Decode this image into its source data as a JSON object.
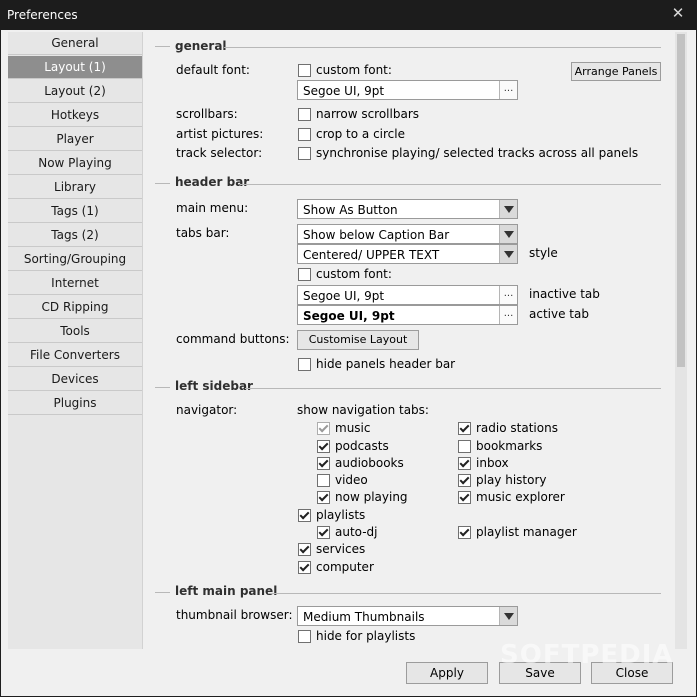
{
  "window": {
    "title": "Preferences",
    "close_glyph": "✕"
  },
  "sidebar": {
    "items": [
      {
        "label": "General"
      },
      {
        "label": "Layout (1)"
      },
      {
        "label": "Layout (2)"
      },
      {
        "label": "Hotkeys"
      },
      {
        "label": "Player"
      },
      {
        "label": "Now Playing"
      },
      {
        "label": "Library"
      },
      {
        "label": "Tags (1)"
      },
      {
        "label": "Tags (2)"
      },
      {
        "label": "Sorting/Grouping"
      },
      {
        "label": "Internet"
      },
      {
        "label": "CD Ripping"
      },
      {
        "label": "Tools"
      },
      {
        "label": "File Converters"
      },
      {
        "label": "Devices"
      },
      {
        "label": "Plugins"
      }
    ],
    "selected": "Layout (1)"
  },
  "general": {
    "heading": "general",
    "default_font_label": "default font:",
    "custom_font_label": "custom font:",
    "custom_font_checked": false,
    "font_value": "Segoe UI, 9pt",
    "arrange_panels": "Arrange Panels",
    "scrollbars_label": "scrollbars:",
    "narrow_scrollbars": "narrow scrollbars",
    "narrow_scrollbars_checked": false,
    "artist_pictures_label": "artist pictures:",
    "crop_circle": "crop to a circle",
    "crop_circle_checked": false,
    "track_selector_label": "track selector:",
    "synchronise": "synchronise playing/ selected tracks across all panels",
    "synchronise_checked": false
  },
  "header_bar": {
    "heading": "header bar",
    "main_menu_label": "main menu:",
    "main_menu_value": "Show As Button",
    "tabs_bar_label": "tabs bar:",
    "tabs_bar_value": "Show below Caption Bar",
    "style_value": "Centered/ UPPER TEXT",
    "style_label": "style",
    "custom_font_label": "custom font:",
    "custom_font_checked": false,
    "inactive_font": "Segoe UI, 9pt",
    "inactive_label": "inactive tab",
    "active_font": "Segoe UI, 9pt",
    "active_label": "active tab",
    "command_buttons_label": "command buttons:",
    "customise_layout": "Customise Layout",
    "hide_panels_header": "hide panels header bar",
    "hide_panels_header_checked": false
  },
  "left_sidebar": {
    "heading": "left sidebar",
    "navigator_label": "navigator:",
    "show_tabs_label": "show navigation tabs:",
    "music": "music",
    "music_checked": true,
    "podcasts": "podcasts",
    "podcasts_checked": true,
    "audiobooks": "audiobooks",
    "audiobooks_checked": true,
    "video": "video",
    "video_checked": false,
    "now_playing": "now playing",
    "now_playing_checked": true,
    "radio_stations": "radio stations",
    "radio_stations_checked": true,
    "bookmarks": "bookmarks",
    "bookmarks_checked": false,
    "inbox": "inbox",
    "inbox_checked": true,
    "play_history": "play history",
    "play_history_checked": true,
    "music_explorer": "music explorer",
    "music_explorer_checked": true,
    "playlists": "playlists",
    "playlists_checked": true,
    "auto_dj": "auto-dj",
    "auto_dj_checked": true,
    "playlist_manager": "playlist manager",
    "playlist_manager_checked": true,
    "services": "services",
    "services_checked": true,
    "computer": "computer",
    "computer_checked": true
  },
  "left_main_panel": {
    "heading": "left main panel",
    "thumbnail_browser_label": "thumbnail browser:",
    "thumbnail_value": "Medium Thumbnails",
    "hide_for_playlists": "hide for playlists",
    "hide_for_playlists_checked": false
  },
  "footer": {
    "apply": "Apply",
    "save": "Save",
    "close": "Close"
  },
  "watermark": "SOFTPEDIA",
  "colors": {
    "selected_bg": "#8e8e8e",
    "sidebar_bg": "#e6e6e6",
    "window_bg": "#f0f0f0",
    "titlebar_bg": "#1c1c1c"
  }
}
